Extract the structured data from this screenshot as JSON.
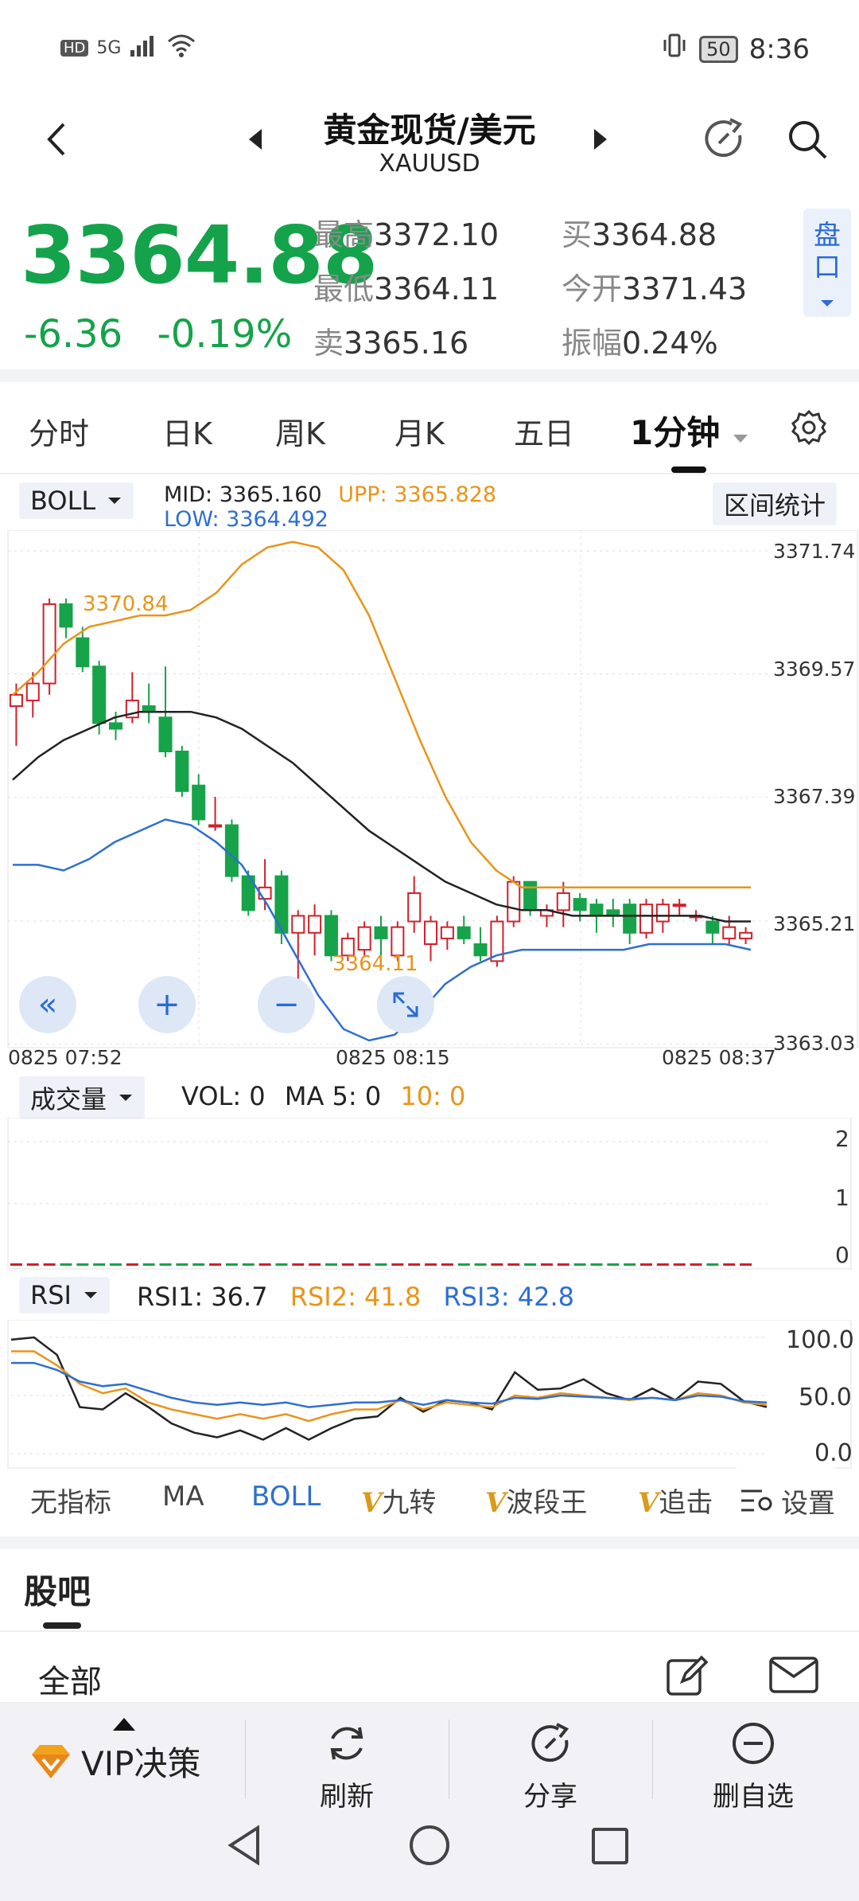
{
  "status_bar": {
    "network": "HD",
    "signal": "5G",
    "battery": "50",
    "time": "8:36"
  },
  "header": {
    "title": "黄金现货/美元",
    "subtitle": "XAUUSD"
  },
  "quote": {
    "price": "3364.88",
    "change": "-6.36",
    "change_pct": "-0.19%",
    "high_label": "最高",
    "high": "3372.10",
    "low_label": "最低",
    "low": "3364.11",
    "sell_label": "卖",
    "sell": "3365.16",
    "buy_label": "买",
    "buy": "3364.88",
    "open_label": "今开",
    "open": "3371.43",
    "amp_label": "振幅",
    "amp": "0.24%",
    "pankou": "盘口"
  },
  "tabs": [
    "分时",
    "日K",
    "周K",
    "月K",
    "五日",
    "1分钟"
  ],
  "active_tab": "1分钟",
  "main_chart": {
    "indicator": "BOLL",
    "mid_label": "MID:",
    "mid": "3365.160",
    "upp_label": "UPP:",
    "upp": "3365.828",
    "low_label": "LOW:",
    "low": "3364.492",
    "range_button": "区间统计",
    "y_ticks": [
      "3371.74",
      "3369.57",
      "3367.39",
      "3365.21",
      "3363.03"
    ],
    "x_ticks": [
      "0825  07:52",
      "0825  08:15",
      "0825  08:37"
    ],
    "max_marker": "3370.84",
    "min_marker": "3364.11",
    "colors": {
      "up": "#d0202a",
      "down": "#17a34a",
      "mid": "#222222",
      "upp": "#e8951a",
      "lowband": "#2f6fd0"
    }
  },
  "chart_data": [
    {
      "type": "candlestick",
      "title": "",
      "x_range": [
        "0825 07:52",
        "0825 08:37"
      ],
      "ylim": [
        3363.03,
        3371.74
      ],
      "y_ticks": [
        3371.74,
        3369.57,
        3367.39,
        3365.21,
        3363.03
      ],
      "candles": [
        {
          "o": 3369.0,
          "h": 3369.4,
          "l": 3368.3,
          "c": 3369.2
        },
        {
          "o": 3369.1,
          "h": 3369.6,
          "l": 3368.8,
          "c": 3369.4
        },
        {
          "o": 3369.4,
          "h": 3370.9,
          "l": 3369.2,
          "c": 3370.8
        },
        {
          "o": 3370.8,
          "h": 3370.9,
          "l": 3370.2,
          "c": 3370.4
        },
        {
          "o": 3370.2,
          "h": 3370.4,
          "l": 3369.6,
          "c": 3369.7
        },
        {
          "o": 3369.7,
          "h": 3369.8,
          "l": 3368.5,
          "c": 3368.7
        },
        {
          "o": 3368.7,
          "h": 3368.9,
          "l": 3368.4,
          "c": 3368.6
        },
        {
          "o": 3368.8,
          "h": 3369.6,
          "l": 3368.7,
          "c": 3369.1
        },
        {
          "o": 3369.0,
          "h": 3369.4,
          "l": 3368.7,
          "c": 3368.9
        },
        {
          "o": 3368.8,
          "h": 3369.7,
          "l": 3368.1,
          "c": 3368.2
        },
        {
          "o": 3368.2,
          "h": 3368.3,
          "l": 3367.4,
          "c": 3367.5
        },
        {
          "o": 3367.6,
          "h": 3367.8,
          "l": 3366.9,
          "c": 3367.0
        },
        {
          "o": 3366.9,
          "h": 3367.4,
          "l": 3366.8,
          "c": 3366.9
        },
        {
          "o": 3366.9,
          "h": 3367.0,
          "l": 3365.9,
          "c": 3366.0
        },
        {
          "o": 3366.0,
          "h": 3366.1,
          "l": 3365.3,
          "c": 3365.4
        },
        {
          "o": 3365.6,
          "h": 3366.3,
          "l": 3365.4,
          "c": 3365.8
        },
        {
          "o": 3366.0,
          "h": 3366.1,
          "l": 3364.8,
          "c": 3365.0
        },
        {
          "o": 3365.0,
          "h": 3365.4,
          "l": 3364.1,
          "c": 3365.3
        },
        {
          "o": 3365.0,
          "h": 3365.5,
          "l": 3364.6,
          "c": 3365.3
        },
        {
          "o": 3365.3,
          "h": 3365.4,
          "l": 3364.5,
          "c": 3364.6
        },
        {
          "o": 3364.6,
          "h": 3365.0,
          "l": 3364.5,
          "c": 3364.9
        },
        {
          "o": 3364.7,
          "h": 3365.2,
          "l": 3364.6,
          "c": 3365.1
        },
        {
          "o": 3365.1,
          "h": 3365.3,
          "l": 3364.5,
          "c": 3364.9
        },
        {
          "o": 3364.6,
          "h": 3365.2,
          "l": 3364.5,
          "c": 3365.1
        },
        {
          "o": 3365.2,
          "h": 3366.0,
          "l": 3365.0,
          "c": 3365.7
        },
        {
          "o": 3364.8,
          "h": 3365.3,
          "l": 3364.5,
          "c": 3365.2
        },
        {
          "o": 3364.9,
          "h": 3365.2,
          "l": 3364.7,
          "c": 3365.1
        },
        {
          "o": 3365.1,
          "h": 3365.3,
          "l": 3364.8,
          "c": 3364.9
        },
        {
          "o": 3364.8,
          "h": 3365.1,
          "l": 3364.5,
          "c": 3364.6
        },
        {
          "o": 3364.5,
          "h": 3365.3,
          "l": 3364.4,
          "c": 3365.2
        },
        {
          "o": 3365.2,
          "h": 3366.0,
          "l": 3365.1,
          "c": 3365.9
        },
        {
          "o": 3365.9,
          "h": 3365.9,
          "l": 3365.3,
          "c": 3365.4
        },
        {
          "o": 3365.3,
          "h": 3365.5,
          "l": 3365.1,
          "c": 3365.4
        },
        {
          "o": 3365.4,
          "h": 3365.9,
          "l": 3365.1,
          "c": 3365.7
        },
        {
          "o": 3365.6,
          "h": 3365.7,
          "l": 3365.2,
          "c": 3365.4
        },
        {
          "o": 3365.5,
          "h": 3365.6,
          "l": 3365.0,
          "c": 3365.3
        },
        {
          "o": 3365.4,
          "h": 3365.6,
          "l": 3365.1,
          "c": 3365.3
        },
        {
          "o": 3365.5,
          "h": 3365.6,
          "l": 3364.8,
          "c": 3365.0
        },
        {
          "o": 3365.0,
          "h": 3365.6,
          "l": 3364.9,
          "c": 3365.5
        },
        {
          "o": 3365.2,
          "h": 3365.6,
          "l": 3365.0,
          "c": 3365.5
        },
        {
          "o": 3365.5,
          "h": 3365.6,
          "l": 3365.3,
          "c": 3365.5
        },
        {
          "o": 3365.3,
          "h": 3365.4,
          "l": 3365.2,
          "c": 3365.3
        },
        {
          "o": 3365.2,
          "h": 3365.3,
          "l": 3364.8,
          "c": 3365.0
        },
        {
          "o": 3364.9,
          "h": 3365.3,
          "l": 3364.8,
          "c": 3365.1
        },
        {
          "o": 3364.9,
          "h": 3365.1,
          "l": 3364.8,
          "c": 3365.0
        }
      ],
      "series": [
        {
          "name": "MID",
          "values": [
            3367.7,
            3368.1,
            3368.4,
            3368.6,
            3368.8,
            3368.9,
            3368.9,
            3368.9,
            3368.8,
            3368.6,
            3368.3,
            3368.0,
            3367.6,
            3367.2,
            3366.8,
            3366.5,
            3366.2,
            3365.9,
            3365.7,
            3365.5,
            3365.4,
            3365.4,
            3365.3,
            3365.3,
            3365.3,
            3365.3,
            3365.3,
            3365.3,
            3365.2,
            3365.2
          ]
        },
        {
          "name": "UPP",
          "values": [
            3369.2,
            3369.6,
            3370.1,
            3370.4,
            3370.5,
            3370.6,
            3370.6,
            3370.7,
            3371.0,
            3371.5,
            3371.8,
            3371.9,
            3371.8,
            3371.4,
            3370.6,
            3369.5,
            3368.4,
            3367.4,
            3366.6,
            3366.1,
            3365.8,
            3365.8,
            3365.8,
            3365.8,
            3365.8,
            3365.8,
            3365.8,
            3365.8,
            3365.8,
            3365.8
          ]
        },
        {
          "name": "LOW",
          "values": [
            3366.2,
            3366.2,
            3366.1,
            3366.3,
            3366.6,
            3366.8,
            3367.0,
            3366.9,
            3366.6,
            3366.2,
            3365.5,
            3364.7,
            3363.9,
            3363.3,
            3363.1,
            3363.2,
            3363.6,
            3364.1,
            3364.4,
            3364.6,
            3364.7,
            3364.7,
            3364.7,
            3364.7,
            3364.7,
            3364.8,
            3364.8,
            3364.8,
            3364.8,
            3364.7
          ]
        }
      ]
    },
    {
      "type": "bar",
      "title": "",
      "ylim": [
        0,
        2
      ],
      "y_ticks": [
        2,
        1,
        0
      ],
      "values": [
        0,
        0,
        0
      ]
    },
    {
      "type": "line",
      "title": "",
      "ylim": [
        0,
        100
      ],
      "y_ticks": [
        100.0,
        50.0,
        0.0
      ],
      "series": [
        {
          "name": "RSI1",
          "values": [
            98,
            100,
            85,
            40,
            38,
            52,
            40,
            26,
            18,
            14,
            20,
            12,
            22,
            12,
            22,
            30,
            32,
            48,
            36,
            46,
            44,
            38,
            70,
            55,
            56,
            64,
            52,
            46,
            56,
            46,
            62,
            60,
            45,
            40
          ]
        },
        {
          "name": "RSI2",
          "values": [
            88,
            88,
            76,
            60,
            52,
            56,
            44,
            38,
            34,
            30,
            34,
            30,
            34,
            28,
            34,
            38,
            38,
            46,
            38,
            44,
            42,
            40,
            50,
            48,
            52,
            50,
            48,
            46,
            48,
            46,
            52,
            50,
            44,
            42
          ]
        },
        {
          "name": "RSI3",
          "values": [
            78,
            78,
            72,
            62,
            58,
            60,
            54,
            48,
            44,
            42,
            44,
            42,
            44,
            40,
            42,
            44,
            44,
            46,
            42,
            46,
            44,
            43,
            48,
            47,
            50,
            49,
            48,
            47,
            48,
            46,
            50,
            49,
            45,
            44
          ]
        }
      ]
    }
  ],
  "volume_chart": {
    "indicator": "成交量",
    "vol_label": "VOL:",
    "vol": "0",
    "ma5_label": "MA 5:",
    "ma5": "0",
    "ma10_label": "10:",
    "ma10": "0",
    "y_ticks": [
      "2",
      "1",
      "0"
    ]
  },
  "rsi_chart": {
    "indicator": "RSI",
    "rsi1_label": "RSI1:",
    "rsi1": "36.7",
    "rsi2_label": "RSI2:",
    "rsi2": "41.8",
    "rsi3_label": "RSI3:",
    "rsi3": "42.8",
    "y_ticks": [
      "100.0",
      "50.0",
      "0.0"
    ]
  },
  "indicator_tabs": {
    "items": [
      "无指标",
      "MA",
      "BOLL",
      "九转",
      "波段王",
      "追击"
    ],
    "vip_prefix": "V",
    "active": "BOLL",
    "settings": "设置"
  },
  "guba": {
    "title": "股吧",
    "filter": "全部"
  },
  "bottom_nav": {
    "vip": "VIP决策",
    "refresh": "刷新",
    "share": "分享",
    "remove": "删自选"
  }
}
